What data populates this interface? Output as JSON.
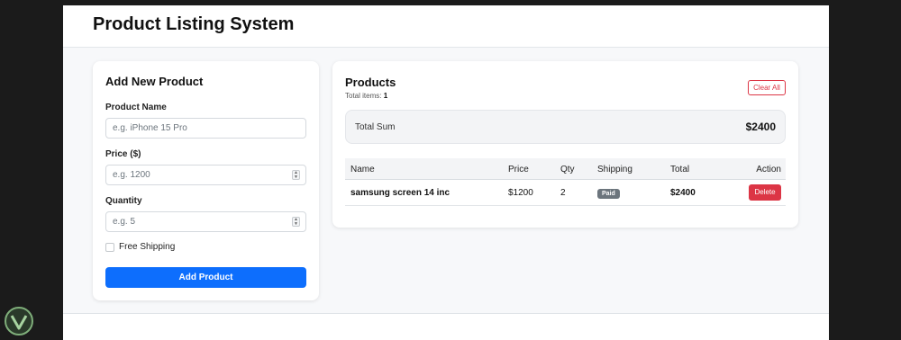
{
  "app": {
    "title": "Product Listing System"
  },
  "form": {
    "title": "Add New Product",
    "name_label": "Product Name",
    "name_placeholder": "e.g. iPhone 15 Pro",
    "price_label": "Price ($)",
    "price_placeholder": "e.g. 1200",
    "quantity_label": "Quantity",
    "quantity_placeholder": "e.g. 5",
    "free_shipping_label": "Free Shipping",
    "free_shipping_checked": false,
    "submit_label": "Add Product"
  },
  "products": {
    "title": "Products",
    "total_items_label": "Total items:",
    "total_items": "1",
    "clear_label": "Clear All",
    "sum_label": "Total Sum",
    "sum_value": "$2400",
    "columns": {
      "name": "Name",
      "price": "Price",
      "qty": "Qty",
      "shipping": "Shipping",
      "total": "Total",
      "action": "Action"
    },
    "rows": [
      {
        "name": "samsung screen 14 inc",
        "price": "$1200",
        "qty": "2",
        "shipping": "Paid",
        "total": "$2400",
        "action": "Delete"
      }
    ]
  },
  "colors": {
    "primary": "#0d6efd",
    "danger": "#dc3545",
    "badge_secondary": "#6c757d"
  },
  "icons": {
    "spinner": "number-spinner-icon",
    "corner": "corner-logo-icon"
  }
}
